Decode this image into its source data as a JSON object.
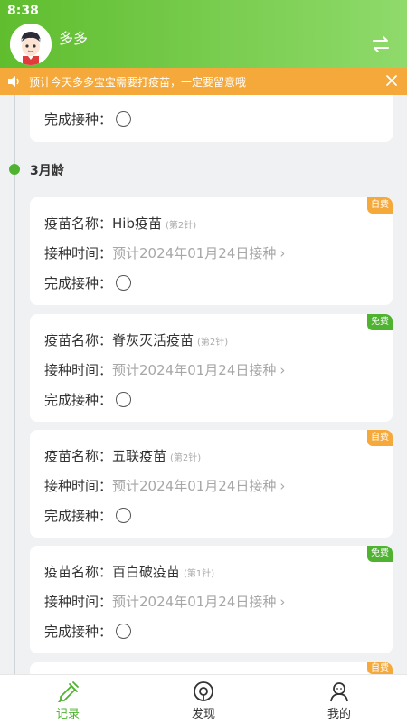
{
  "status_bar": {
    "time": "8:38"
  },
  "header": {
    "user_name": "多多"
  },
  "notice": {
    "text": "预计今天多多宝宝需要打疫苗，一定要留意哦"
  },
  "timeline": {
    "age_label": "3月龄"
  },
  "labels": {
    "vaccine_name": "疫苗名称：",
    "schedule": "接种时间：",
    "done": "完成接种："
  },
  "top_partial_card": {
    "done_label": "完成接种："
  },
  "cards": [
    {
      "name": "Hib疫苗",
      "dose": "(第2针)",
      "schedule": "预计2024年01月24日接种",
      "badge": "自费",
      "badge_type": "self"
    },
    {
      "name": "脊灰灭活疫苗",
      "dose": "(第2针)",
      "schedule": "预计2024年01月24日接种",
      "badge": "免费",
      "badge_type": "free"
    },
    {
      "name": "五联疫苗",
      "dose": "(第2针)",
      "schedule": "预计2024年01月24日接种",
      "badge": "自费",
      "badge_type": "self"
    },
    {
      "name": "百白破疫苗",
      "dose": "(第1针)",
      "schedule": "预计2024年01月24日接种",
      "badge": "免费",
      "badge_type": "free"
    }
  ],
  "bottom_partial_card": {
    "badge": "自费"
  },
  "bottom_nav": [
    {
      "label": "记录",
      "icon": "record-icon",
      "active": true
    },
    {
      "label": "发现",
      "icon": "discover-icon",
      "active": false
    },
    {
      "label": "我的",
      "icon": "profile-icon",
      "active": false
    }
  ],
  "colors": {
    "accent": "#4fb331",
    "notice": "#f4a93a"
  }
}
